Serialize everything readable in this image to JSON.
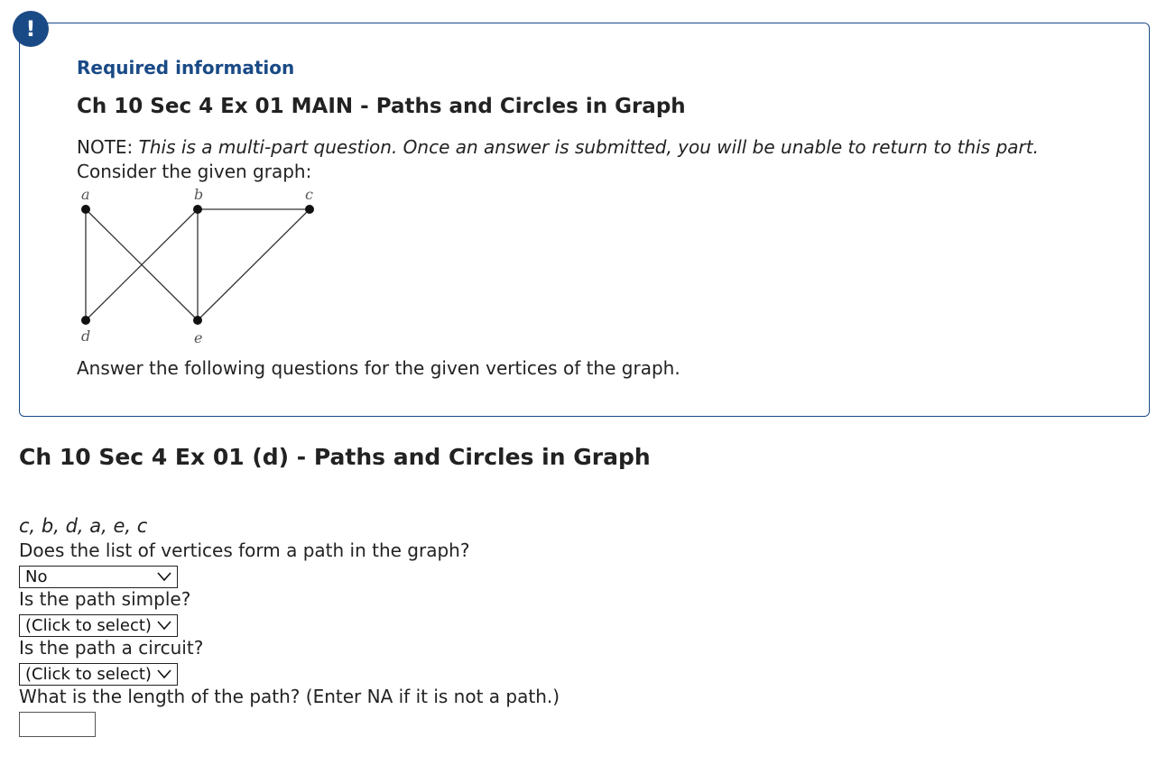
{
  "alert": {
    "glyph": "!",
    "icon": "exclamation-icon",
    "color": "#1a4a86"
  },
  "intro": {
    "required_label": "Required information",
    "title": "Ch 10 Sec 4 Ex 01 MAIN - Paths and Circles in Graph",
    "note_prefix": "NOTE: ",
    "note_text": "This is a multi-part question. Once an answer is submitted, you will be unable to return to this part.",
    "consider": "Consider the given graph:",
    "instruction": "Answer the following questions for the given vertices of the graph."
  },
  "graph": {
    "vertices": [
      "a",
      "b",
      "c",
      "d",
      "e"
    ],
    "edges": [
      [
        "a",
        "d"
      ],
      [
        "a",
        "e"
      ],
      [
        "b",
        "d"
      ],
      [
        "b",
        "e"
      ],
      [
        "b",
        "c"
      ],
      [
        "c",
        "e"
      ]
    ]
  },
  "section": {
    "title": "Ch 10 Sec 4 Ex 01 (d) - Paths and Circles in Graph",
    "vertex_list": "c, b, d, a, e, c"
  },
  "questions": {
    "q1": {
      "text": "Does the list of vertices form a path in the graph?",
      "selected": "No"
    },
    "q2": {
      "text": "Is the path simple?",
      "selected": "(Click to select)"
    },
    "q3": {
      "text": "Is the path a circuit?",
      "selected": "(Click to select)"
    },
    "q4": {
      "text": "What is the length of the path? (Enter NA if it is not a path.)",
      "value": ""
    }
  }
}
